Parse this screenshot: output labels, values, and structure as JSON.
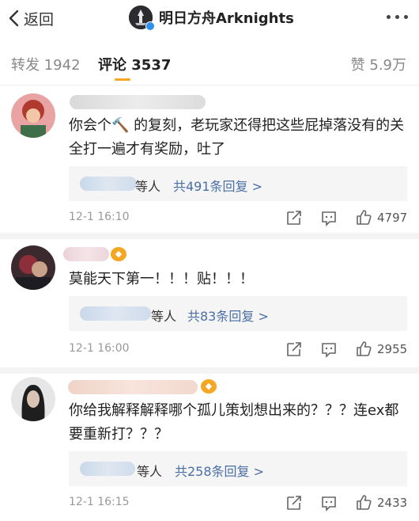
{
  "header": {
    "back_label": "返回",
    "title": "明日方舟Arknights"
  },
  "tabs": {
    "repost": "转发 1942",
    "comment": "评论 3537",
    "like": "赞 5.9万"
  },
  "comments": [
    {
      "text": "你会个🔨 的复刻，老玩家还得把这些屁掉落没有的关全打一遍才有奖励，吐了",
      "reply_people": "等人",
      "reply_count": "共491条回复 >",
      "time": "12-1 16:10",
      "likes": "4797"
    },
    {
      "text": "莫能天下第一！！！贴！！！",
      "reply_people": "等人",
      "reply_count": "共83条回复 >",
      "time": "12-1 16:00",
      "likes": "2955"
    },
    {
      "text": "你给我解释解释哪个孤儿策划想出来的？？？连ex都要重新打？？？",
      "reply_people": "等人",
      "reply_count": "共258条回复 >",
      "time": "12-1 16:15",
      "likes": "2433"
    }
  ],
  "icons": {
    "back": "chevron-left-icon",
    "more": "more-dots-icon",
    "share": "share-icon",
    "comment": "comment-icon",
    "like": "thumbs-up-icon"
  },
  "colors": {
    "accent": "#f6a623",
    "link": "#4a6fa5",
    "verify": "#2d8ff0"
  }
}
